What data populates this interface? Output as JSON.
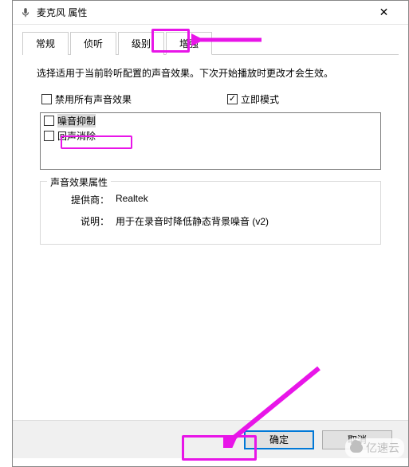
{
  "window": {
    "title": "麦克风 属性",
    "close_icon": "✕"
  },
  "tabs": {
    "items": [
      "常规",
      "侦听",
      "级别",
      "增强"
    ],
    "active_index": 3
  },
  "panel": {
    "description": "选择适用于当前聆听配置的声音效果。下次开始播放时更改才会生效。",
    "disable_all_label": "禁用所有声音效果",
    "disable_all_checked": false,
    "instant_mode_label": "立即模式",
    "instant_mode_checked": true,
    "effects": [
      {
        "label": "噪音抑制",
        "checked": false,
        "selected": true
      },
      {
        "label": "回声消除",
        "checked": false,
        "selected": false
      }
    ]
  },
  "group": {
    "title": "声音效果属性",
    "provider_label": "提供商：",
    "provider_value": "Realtek",
    "desc_label": "说明：",
    "desc_value": "用于在录音时降低静态背景噪音 (v2)"
  },
  "buttons": {
    "ok": "确定",
    "cancel": "取消"
  },
  "watermark": "亿速云"
}
